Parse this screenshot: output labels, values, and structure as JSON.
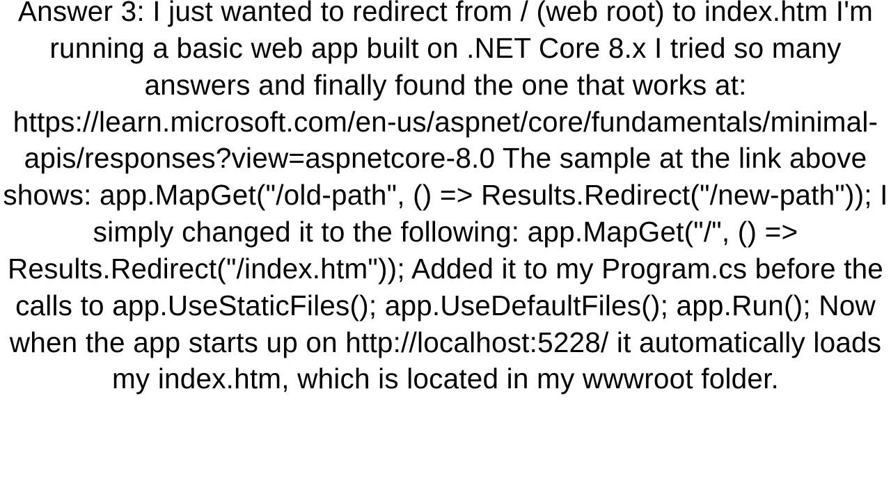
{
  "answer": {
    "text": "Answer 3: I just wanted to redirect from / (web root) to index.htm I'm running a basic web app built on .NET Core 8.x I tried so many answers and finally found the one that works at: https://learn.microsoft.com/en-us/aspnet/core/fundamentals/minimal-apis/responses?view=aspnetcore-8.0 The sample at the link above shows: app.MapGet(\"/old-path\", () => Results.Redirect(\"/new-path\"));  I simply changed it to the following: app.MapGet(\"/\", () => Results.Redirect(\"/index.htm\"));  Added it to my Program.cs before the calls to app.UseStaticFiles(); app.UseDefaultFiles(); app.Run();  Now when the app starts up on http://localhost:5228/ it automatically loads my index.htm, which is located in my wwwroot folder."
  }
}
